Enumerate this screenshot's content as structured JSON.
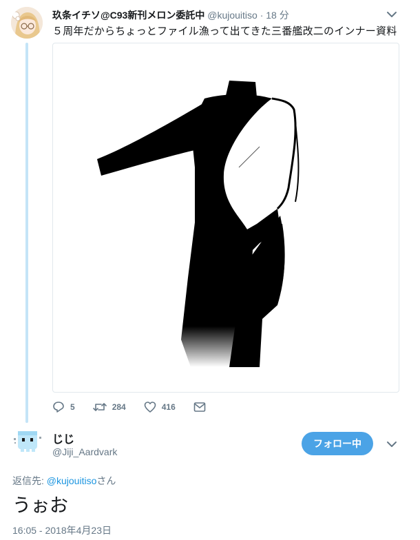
{
  "tweet": {
    "author_name": "玖条イチソ@C93新刊メロン委託中",
    "author_handle": "@kujouitiso",
    "separator": "·",
    "time": "18 分",
    "text": "５周年だからちょっとファイル漁って出てきた三番艦改二のインナー資料",
    "image": "black-inner-bodysuit-illustration",
    "actions": {
      "reply_count": "5",
      "retweet_count": "284",
      "like_count": "416"
    }
  },
  "reply": {
    "author_name": "じじ",
    "author_handle": "@Jiji_Aardvark",
    "follow_label": "フォロー中",
    "replying_prefix": "返信先: ",
    "replying_mention": "@kujouitiso",
    "replying_suffix": "さん",
    "text": "うぉお",
    "timestamp": "16:05 - 2018年4月23日"
  },
  "colors": {
    "accent": "#1b95e0",
    "follow_button": "#4ba3e6",
    "thread_line": "#c4e4f7",
    "secondary_text": "#657786"
  }
}
